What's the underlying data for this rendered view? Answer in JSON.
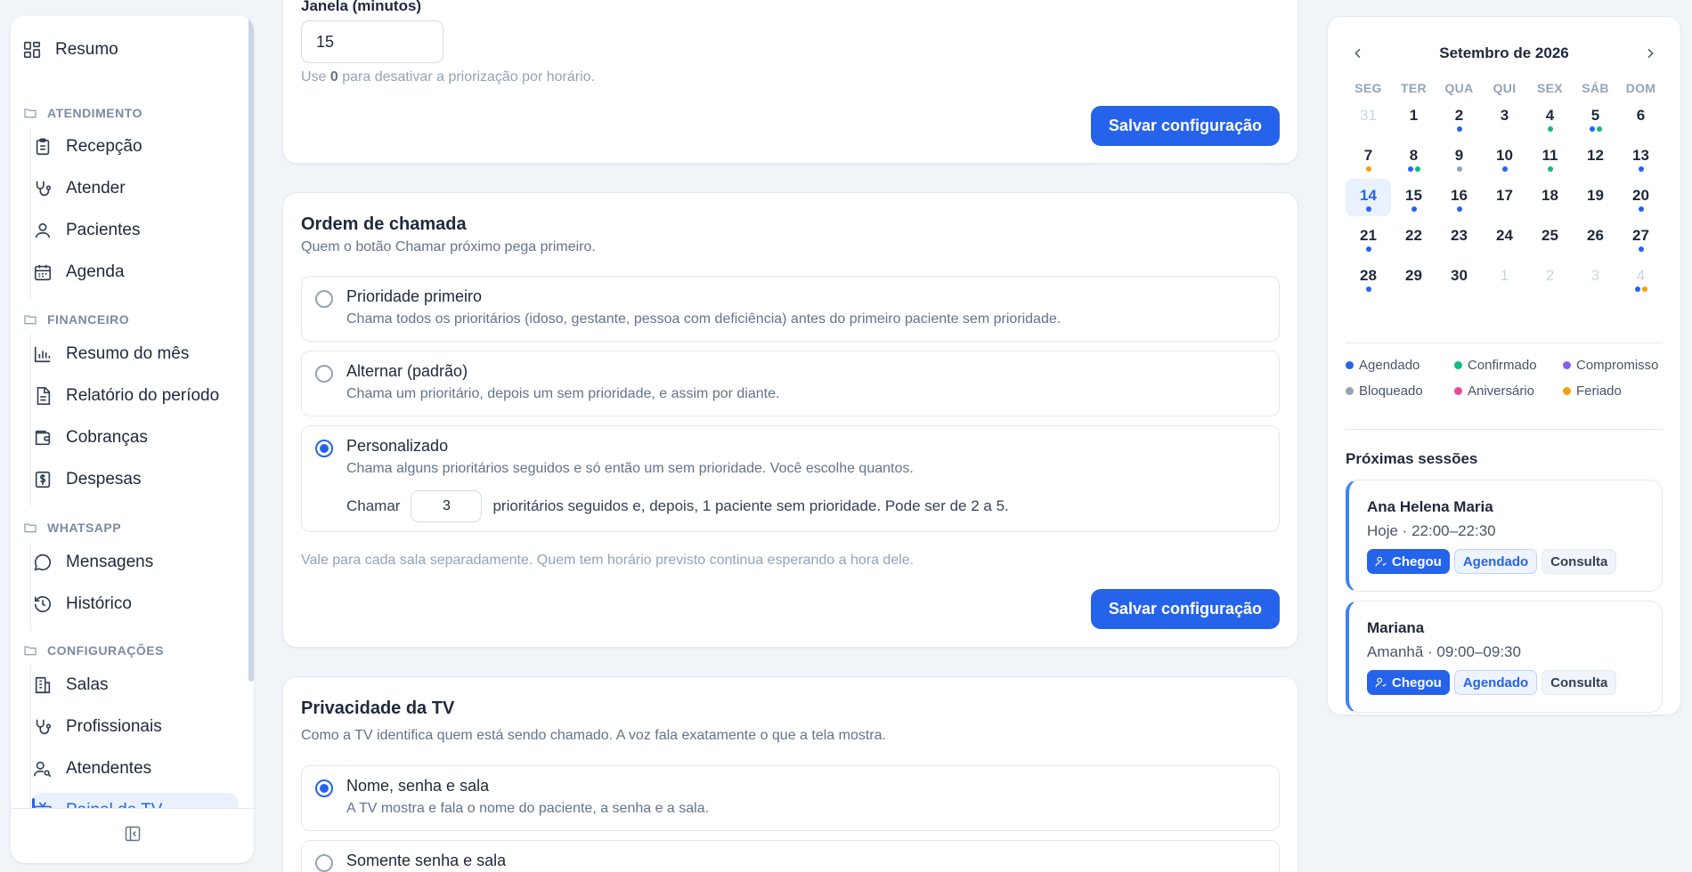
{
  "sidebar": {
    "top_item": "Resumo",
    "groups": [
      {
        "label": "ATENDIMENTO",
        "items": [
          "Recepção",
          "Atender",
          "Pacientes",
          "Agenda"
        ]
      },
      {
        "label": "FINANCEIRO",
        "items": [
          "Resumo do mês",
          "Relatório do período",
          "Cobranças",
          "Despesas"
        ]
      },
      {
        "label": "WHATSAPP",
        "items": [
          "Mensagens",
          "Histórico"
        ]
      },
      {
        "label": "CONFIGURAÇÕES",
        "items": [
          "Salas",
          "Profissionais",
          "Atendentes",
          "Painel de TV"
        ]
      }
    ],
    "active_item": "Painel de TV"
  },
  "time_window": {
    "label": "Janela (minutos)",
    "value": "15",
    "hint_prefix": "Use ",
    "hint_bold": "0",
    "hint_suffix": " para desativar a priorização por horário.",
    "save_label": "Salvar configuração"
  },
  "call_order": {
    "title": "Ordem de chamada",
    "subtitle": "Quem o botão Chamar próximo pega primeiro.",
    "options": [
      {
        "title": "Prioridade primeiro",
        "desc": "Chama todos os prioritários (idoso, gestante, pessoa com deficiência) antes do primeiro paciente sem prioridade.",
        "selected": false
      },
      {
        "title": "Alternar (padrão)",
        "desc": "Chama um prioritário, depois um sem prioridade, e assim por diante.",
        "selected": false
      },
      {
        "title": "Personalizado",
        "desc": "Chama alguns prioritários seguidos e só então um sem prioridade. Você escolhe quantos.",
        "selected": true
      }
    ],
    "custom_prefix": "Chamar",
    "custom_value": "3",
    "custom_suffix": "prioritários seguidos e, depois, 1 paciente sem prioridade. Pode ser de 2 a 5.",
    "note": "Vale para cada sala separadamente. Quem tem horário previsto continua esperando a hora dele.",
    "save_label": "Salvar configuração"
  },
  "tv_privacy": {
    "title": "Privacidade da TV",
    "subtitle": "Como a TV identifica quem está sendo chamado. A voz fala exatamente o que a tela mostra.",
    "options": [
      {
        "title": "Nome, senha e sala",
        "desc": "A TV mostra e fala o nome do paciente, a senha e a sala.",
        "selected": true
      },
      {
        "title": "Somente senha e sala",
        "desc": "",
        "selected": false
      }
    ]
  },
  "calendar": {
    "title": "Setembro de 2026",
    "weekdays": [
      "SEG",
      "TER",
      "QUA",
      "QUI",
      "SEX",
      "SÁB",
      "DOM"
    ],
    "weeks": [
      [
        {
          "d": "31",
          "m": true,
          "c": []
        },
        {
          "d": "1",
          "c": []
        },
        {
          "d": "2",
          "c": [
            "blue"
          ]
        },
        {
          "d": "3",
          "c": []
        },
        {
          "d": "4",
          "c": [
            "green"
          ]
        },
        {
          "d": "5",
          "c": [
            "blue",
            "green"
          ]
        },
        {
          "d": "6",
          "c": []
        }
      ],
      [
        {
          "d": "7",
          "c": [
            "orange"
          ]
        },
        {
          "d": "8",
          "c": [
            "blue",
            "green"
          ]
        },
        {
          "d": "9",
          "c": [
            "gray"
          ]
        },
        {
          "d": "10",
          "c": [
            "blue"
          ]
        },
        {
          "d": "11",
          "c": [
            "green"
          ]
        },
        {
          "d": "12",
          "c": []
        },
        {
          "d": "13",
          "c": [
            "blue"
          ]
        }
      ],
      [
        {
          "d": "14",
          "t": true,
          "c": [
            "blue"
          ]
        },
        {
          "d": "15",
          "c": [
            "blue"
          ]
        },
        {
          "d": "16",
          "c": [
            "blue"
          ]
        },
        {
          "d": "17",
          "c": []
        },
        {
          "d": "18",
          "c": []
        },
        {
          "d": "19",
          "c": []
        },
        {
          "d": "20",
          "c": [
            "blue"
          ]
        }
      ],
      [
        {
          "d": "21",
          "c": [
            "blue"
          ]
        },
        {
          "d": "22",
          "c": []
        },
        {
          "d": "23",
          "c": []
        },
        {
          "d": "24",
          "c": []
        },
        {
          "d": "25",
          "c": []
        },
        {
          "d": "26",
          "c": []
        },
        {
          "d": "27",
          "c": [
            "blue"
          ]
        }
      ],
      [
        {
          "d": "28",
          "c": [
            "blue"
          ]
        },
        {
          "d": "29",
          "c": []
        },
        {
          "d": "30",
          "c": []
        },
        {
          "d": "1",
          "m": true,
          "c": []
        },
        {
          "d": "2",
          "m": true,
          "c": []
        },
        {
          "d": "3",
          "m": true,
          "c": []
        },
        {
          "d": "4",
          "m": true,
          "c": [
            "blue",
            "orange"
          ]
        }
      ]
    ],
    "legend": [
      {
        "label": "Agendado",
        "color": "#2563eb"
      },
      {
        "label": "Confirmado",
        "color": "#10b981"
      },
      {
        "label": "Compromisso",
        "color": "#8b5cf6"
      },
      {
        "label": "Bloqueado",
        "color": "#94a3b8"
      },
      {
        "label": "Aniversário",
        "color": "#ec4899"
      },
      {
        "label": "Feriado",
        "color": "#f59e0b"
      }
    ]
  },
  "sessions": {
    "title": "Próximas sessões",
    "items": [
      {
        "name": "Ana Helena Maria",
        "time": "Hoje · 22:00–22:30",
        "action": "Chegou",
        "status": "Agendado",
        "type": "Consulta"
      },
      {
        "name": "Mariana",
        "time": "Amanhã · 09:00–09:30",
        "action": "Chegou",
        "status": "Agendado",
        "type": "Consulta"
      }
    ]
  },
  "colors": {
    "accent": "#2563eb",
    "blue": "#2563eb",
    "green": "#10b981",
    "gray": "#94a3b8",
    "orange": "#f59e0b"
  }
}
